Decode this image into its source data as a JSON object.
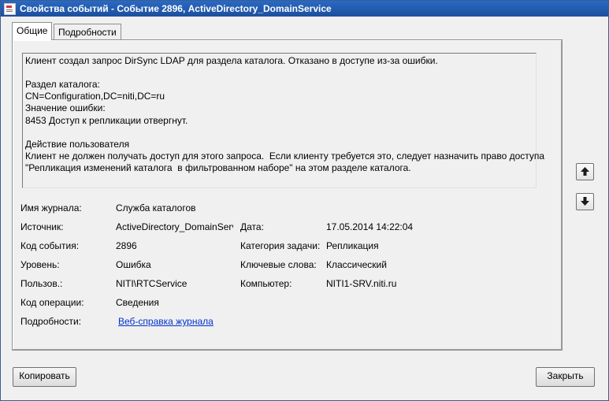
{
  "window": {
    "title": "Свойства событий - Событие 2896, ActiveDirectory_DomainService"
  },
  "tabs": [
    {
      "label": "Общие",
      "active": true
    },
    {
      "label": "Подробности",
      "active": false
    }
  ],
  "description": {
    "lines": [
      "Клиент создал запрос DirSync LDAP для раздела каталога. Отказано в доступе из-за ошибки.",
      "",
      "Раздел каталога:",
      "CN=Configuration,DC=niti,DC=ru",
      "Значение ошибки:",
      "8453 Доступ к репликации отвергнут.",
      "",
      "Действие пользователя",
      "Клиент не должен получать доступ для этого запроса.  Если клиенту требуется это, следует назначить право доступа",
      "\"Репликация изменений каталога  в фильтрованном наборе\" на этом разделе каталога."
    ]
  },
  "fields": {
    "log_name": {
      "label": "Имя журнала:",
      "value": "Служба каталогов"
    },
    "source": {
      "label": "Источник:",
      "value": "ActiveDirectory_DomainService"
    },
    "date": {
      "label": "Дата:",
      "value": "17.05.2014 14:22:04"
    },
    "event_id": {
      "label": "Код события:",
      "value": "2896"
    },
    "task_category": {
      "label": "Категория задачи:",
      "value": "Репликация"
    },
    "level": {
      "label": "Уровень:",
      "value": "Ошибка"
    },
    "keywords": {
      "label": "Ключевые слова:",
      "value": "Классический"
    },
    "user": {
      "label": "Пользов.:",
      "value": "NITI\\RTCService"
    },
    "computer": {
      "label": "Компьютер:",
      "value": "NITI1-SRV.niti.ru"
    },
    "opcode": {
      "label": "Код операции:",
      "value": "Сведения"
    },
    "more_info": {
      "label": "Подробности:",
      "value": "Веб-справка журнала"
    }
  },
  "buttons": {
    "copy": "Копировать",
    "close": "Закрыть"
  },
  "icons": {
    "scroll_up": "arrow-up-icon",
    "scroll_down": "arrow-down-icon"
  }
}
